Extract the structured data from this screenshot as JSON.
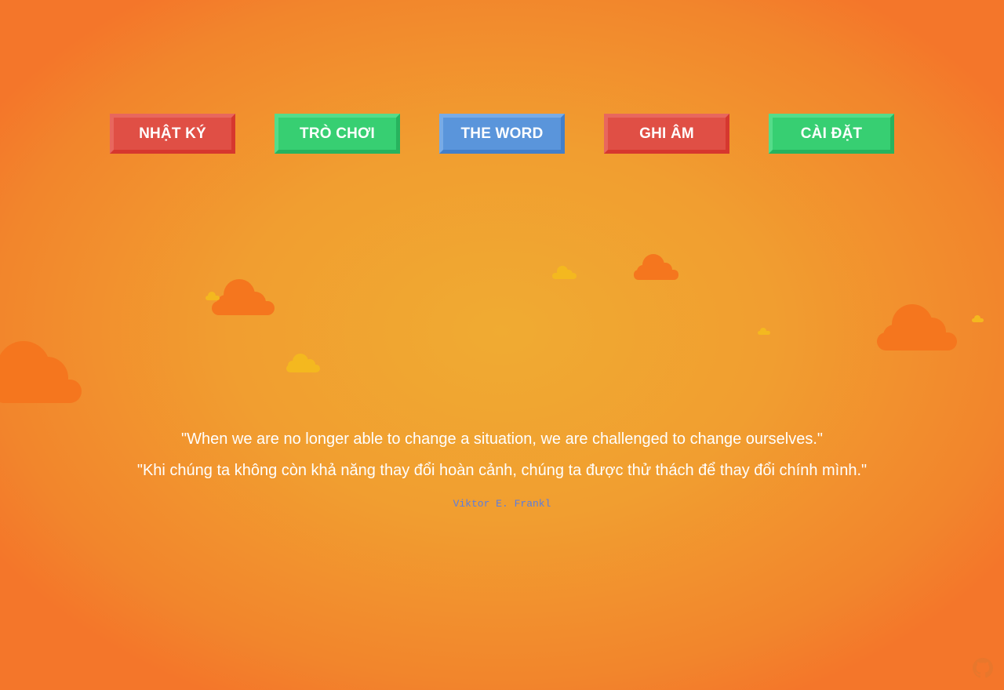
{
  "nav": {
    "items": [
      {
        "label": "NHẬT KÝ",
        "color": "red"
      },
      {
        "label": "TRÒ CHƠI",
        "color": "green"
      },
      {
        "label": "THE WORD",
        "color": "blue"
      },
      {
        "label": "GHI ÂM",
        "color": "red"
      },
      {
        "label": "CÀI ĐẶT",
        "color": "green"
      }
    ]
  },
  "quote": {
    "english": "\"When we are no longer able to change a situation, we are challenged to change ourselves.\"",
    "vietnamese": "\"Khi chúng ta không còn khả năng thay đổi hoàn cảnh, chúng ta được thử thách để thay đổi chính mình.\"",
    "author": "Viktor E. Frankl"
  },
  "icons": {
    "github": "github-icon",
    "cloud": "cloud-icon"
  },
  "colors": {
    "background_center": "#f0ab32",
    "background_edge": "#f4762a",
    "button_red": "#e04f45",
    "button_green": "#37cf72",
    "button_blue": "#5a95db",
    "cloud_orange": "#f5761e",
    "cloud_yellow": "#f4b81f",
    "author_text": "#5a7de0"
  }
}
